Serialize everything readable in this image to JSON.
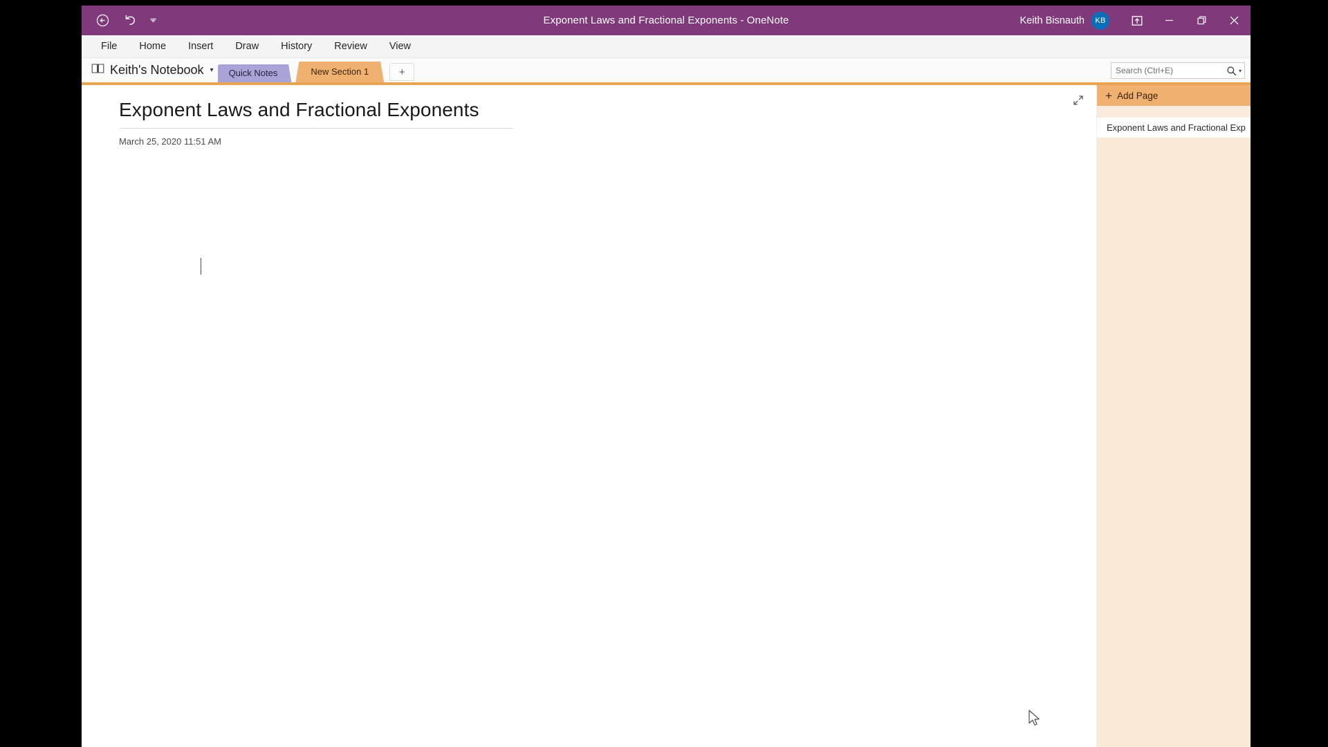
{
  "titlebar": {
    "document_title": "Exponent Laws and Fractional Exponents",
    "separator": "-",
    "app_name": "OneNote",
    "full_title": "Exponent Laws and Fractional Exponents  -  OneNote",
    "user_name": "Keith Bisnauth",
    "avatar_initials": "KB",
    "quick_access": [
      {
        "name": "back-button",
        "glyph": "←"
      },
      {
        "name": "undo-button",
        "glyph": "↶"
      },
      {
        "name": "customize-qat-caret",
        "glyph": "▾"
      }
    ],
    "window_controls": [
      {
        "name": "ribbon-display-options-button",
        "glyph": "⬆"
      },
      {
        "name": "minimize-button",
        "glyph": "—"
      },
      {
        "name": "restore-button",
        "glyph": "❐"
      },
      {
        "name": "close-button",
        "glyph": "✕"
      }
    ],
    "accent_color": "#80397b",
    "avatar_color": "#0a6fbb"
  },
  "ribbon": {
    "tabs": [
      {
        "label": "File"
      },
      {
        "label": "Home"
      },
      {
        "label": "Insert"
      },
      {
        "label": "Draw"
      },
      {
        "label": "History"
      },
      {
        "label": "Review"
      },
      {
        "label": "View"
      }
    ]
  },
  "sectionbar": {
    "notebook_name": "Keith's Notebook",
    "notebook_caret": "▾",
    "sections": [
      {
        "label": "Quick Notes",
        "color": "#aaa3d8",
        "active": false
      },
      {
        "label": "New Section 1",
        "color": "#f0b070",
        "active": true
      }
    ],
    "add_section_label": "+",
    "accent_bar_color": "#e8a44f"
  },
  "search": {
    "placeholder": "Search (Ctrl+E)",
    "value": "",
    "icon": "search-icon",
    "caret": "▾"
  },
  "page": {
    "title": "Exponent Laws and Fractional Exponents",
    "date": "March 25, 2020",
    "time": "11:51 AM",
    "body_text": ""
  },
  "pagelist": {
    "add_page_label": "Add Page",
    "add_page_plus": "+",
    "items": [
      {
        "label": "Exponent Laws and Fractional Exp",
        "selected": true
      }
    ],
    "header_color": "#f0b070",
    "background_color": "#fbe9d8"
  }
}
